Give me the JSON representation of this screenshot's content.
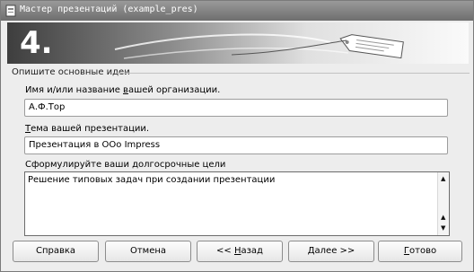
{
  "window": {
    "title": "Мастер презентаций (example_pres)"
  },
  "banner": {
    "step_number": "4."
  },
  "section": {
    "label": "Опишите основные идеи"
  },
  "fields": {
    "org_label_pre": "Имя и/или название ",
    "org_label_ul": "в",
    "org_label_post": "ашей организации.",
    "org_value": "А.Ф.Тор",
    "topic_label_ul": "Т",
    "topic_label_post": "ема вашей презентации.",
    "topic_value": "Презентация в OOo Impress",
    "goals_label": "Сформулируйте ваши долгосрочные цели",
    "goals_value": "Решение типовых задач при создании презентации"
  },
  "buttons": {
    "help": "Справка",
    "cancel": "Отмена",
    "back_pre": "<< ",
    "back_ul": "Н",
    "back_post": "азад",
    "next_ul": "Д",
    "next_post": "алее >>",
    "finish_ul": "Г",
    "finish_post": "отово"
  },
  "colors": {
    "titlebar": "#7f7f7f",
    "dialog_bg": "#ededed"
  },
  "icons": {
    "window": "presentation-wizard-icon",
    "banner": "luggage-tag-icon"
  }
}
